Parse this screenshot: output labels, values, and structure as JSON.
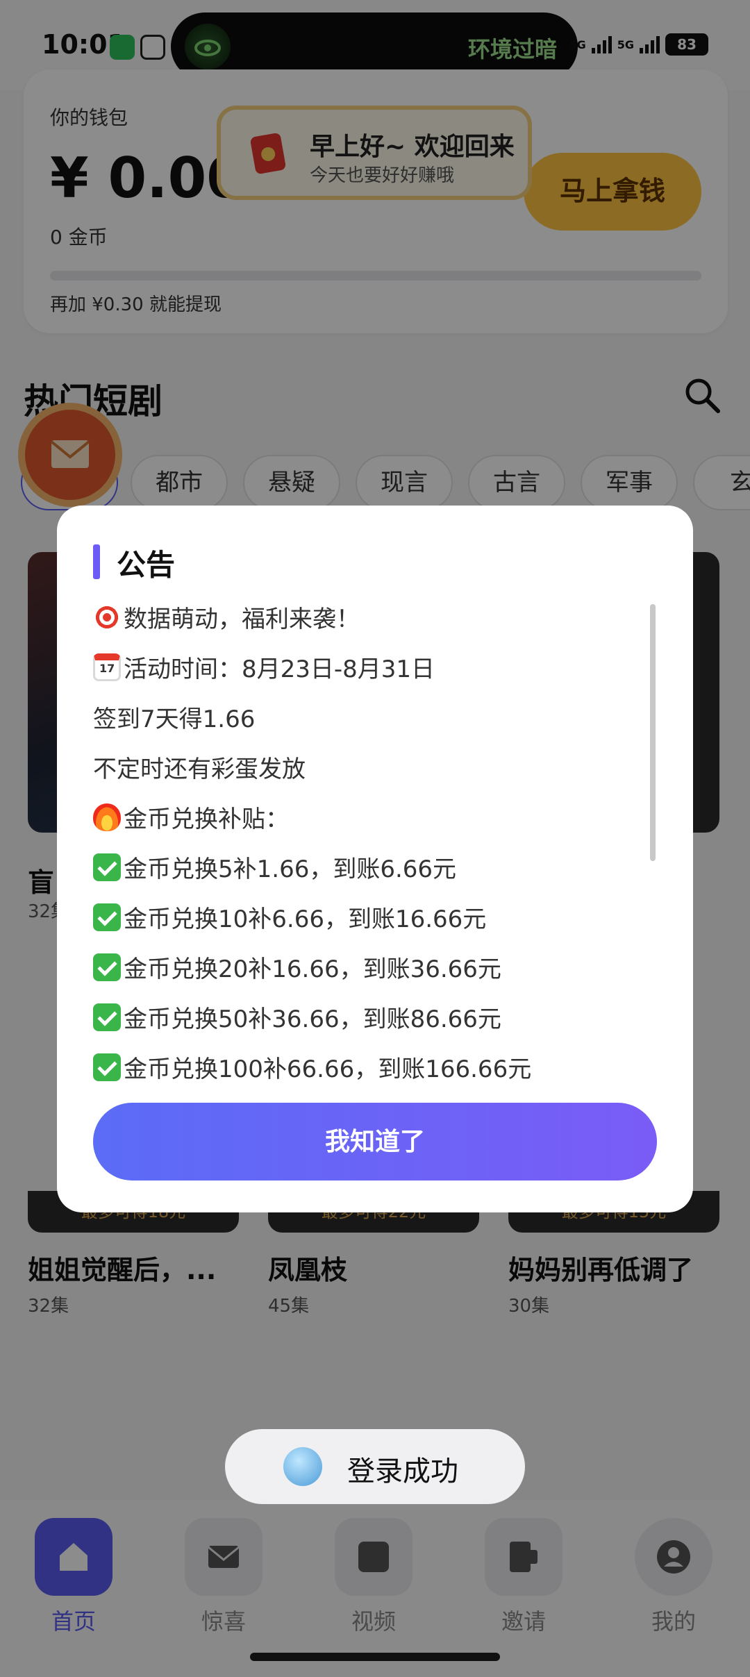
{
  "status_bar": {
    "time": "10:01",
    "island_text": "环境过暗",
    "signal_1": "5G",
    "signal_2": "5G",
    "battery": "83"
  },
  "wallet": {
    "title": "你的钱包",
    "amount": "¥ 0.00",
    "coins": "0 金币",
    "withdraw_hint": "再加 ¥0.30 就能提现",
    "progress": 0,
    "cta_label": "马上拿钱"
  },
  "greeting": {
    "title": "早上好~ 欢迎回来",
    "subtitle": "今天也要好好赚哦"
  },
  "section": {
    "title": "热门短剧"
  },
  "tabs": [
    "都市",
    "悬疑",
    "现言",
    "古言",
    "军事",
    "玄"
  ],
  "background_dramas": {
    "first_name": "盲",
    "first_eps": "32集"
  },
  "cards": [
    {
      "reward": "最多可得18元",
      "title": "姐姐觉醒后，...",
      "eps": "32集"
    },
    {
      "reward": "最多可得22元",
      "title": "凤凰枝",
      "eps": "45集"
    },
    {
      "reward": "最多可得15元",
      "title": "妈妈别再低调了",
      "eps": "30集"
    }
  ],
  "modal": {
    "title": "公告",
    "lines": [
      {
        "icon": "target-emoji",
        "text": "数据萌动，福利来袭！"
      },
      {
        "icon": "calendar-emoji",
        "text": "活动时间：8月23日-8月31日"
      },
      {
        "icon": "",
        "text": "签到7天得1.66"
      },
      {
        "icon": "",
        "text": "不定时还有彩蛋发放"
      },
      {
        "icon": "fire-emoji",
        "text": "金币兑换补贴："
      },
      {
        "icon": "check-emoji",
        "text": "金币兑换5补1.66，到账6.66元"
      },
      {
        "icon": "check-emoji",
        "text": "金币兑换10补6.66，到账16.66元"
      },
      {
        "icon": "check-emoji",
        "text": "金币兑换20补16.66，到账36.66元"
      },
      {
        "icon": "check-emoji",
        "text": "金币兑换50补36.66，到账86.66元"
      },
      {
        "icon": "check-emoji",
        "text": "金币兑换100补66.66，到账166.66元"
      }
    ],
    "button_label": "我知道了"
  },
  "toast": {
    "text": "登录成功"
  },
  "bottom_nav": [
    {
      "label": "首页",
      "icon": "home-icon",
      "active": true
    },
    {
      "label": "惊喜",
      "icon": "mail-icon",
      "active": false
    },
    {
      "label": "视频",
      "icon": "video-icon",
      "active": false
    },
    {
      "label": "邀请",
      "icon": "invite-icon",
      "active": false
    },
    {
      "label": "我的",
      "icon": "profile-icon",
      "active": false
    }
  ],
  "colors": {
    "accent": "#5b5bf2",
    "wallet_cta": "#ffc542",
    "modal_button_start": "#5b6cf6",
    "modal_button_end": "#7a5cf6"
  }
}
